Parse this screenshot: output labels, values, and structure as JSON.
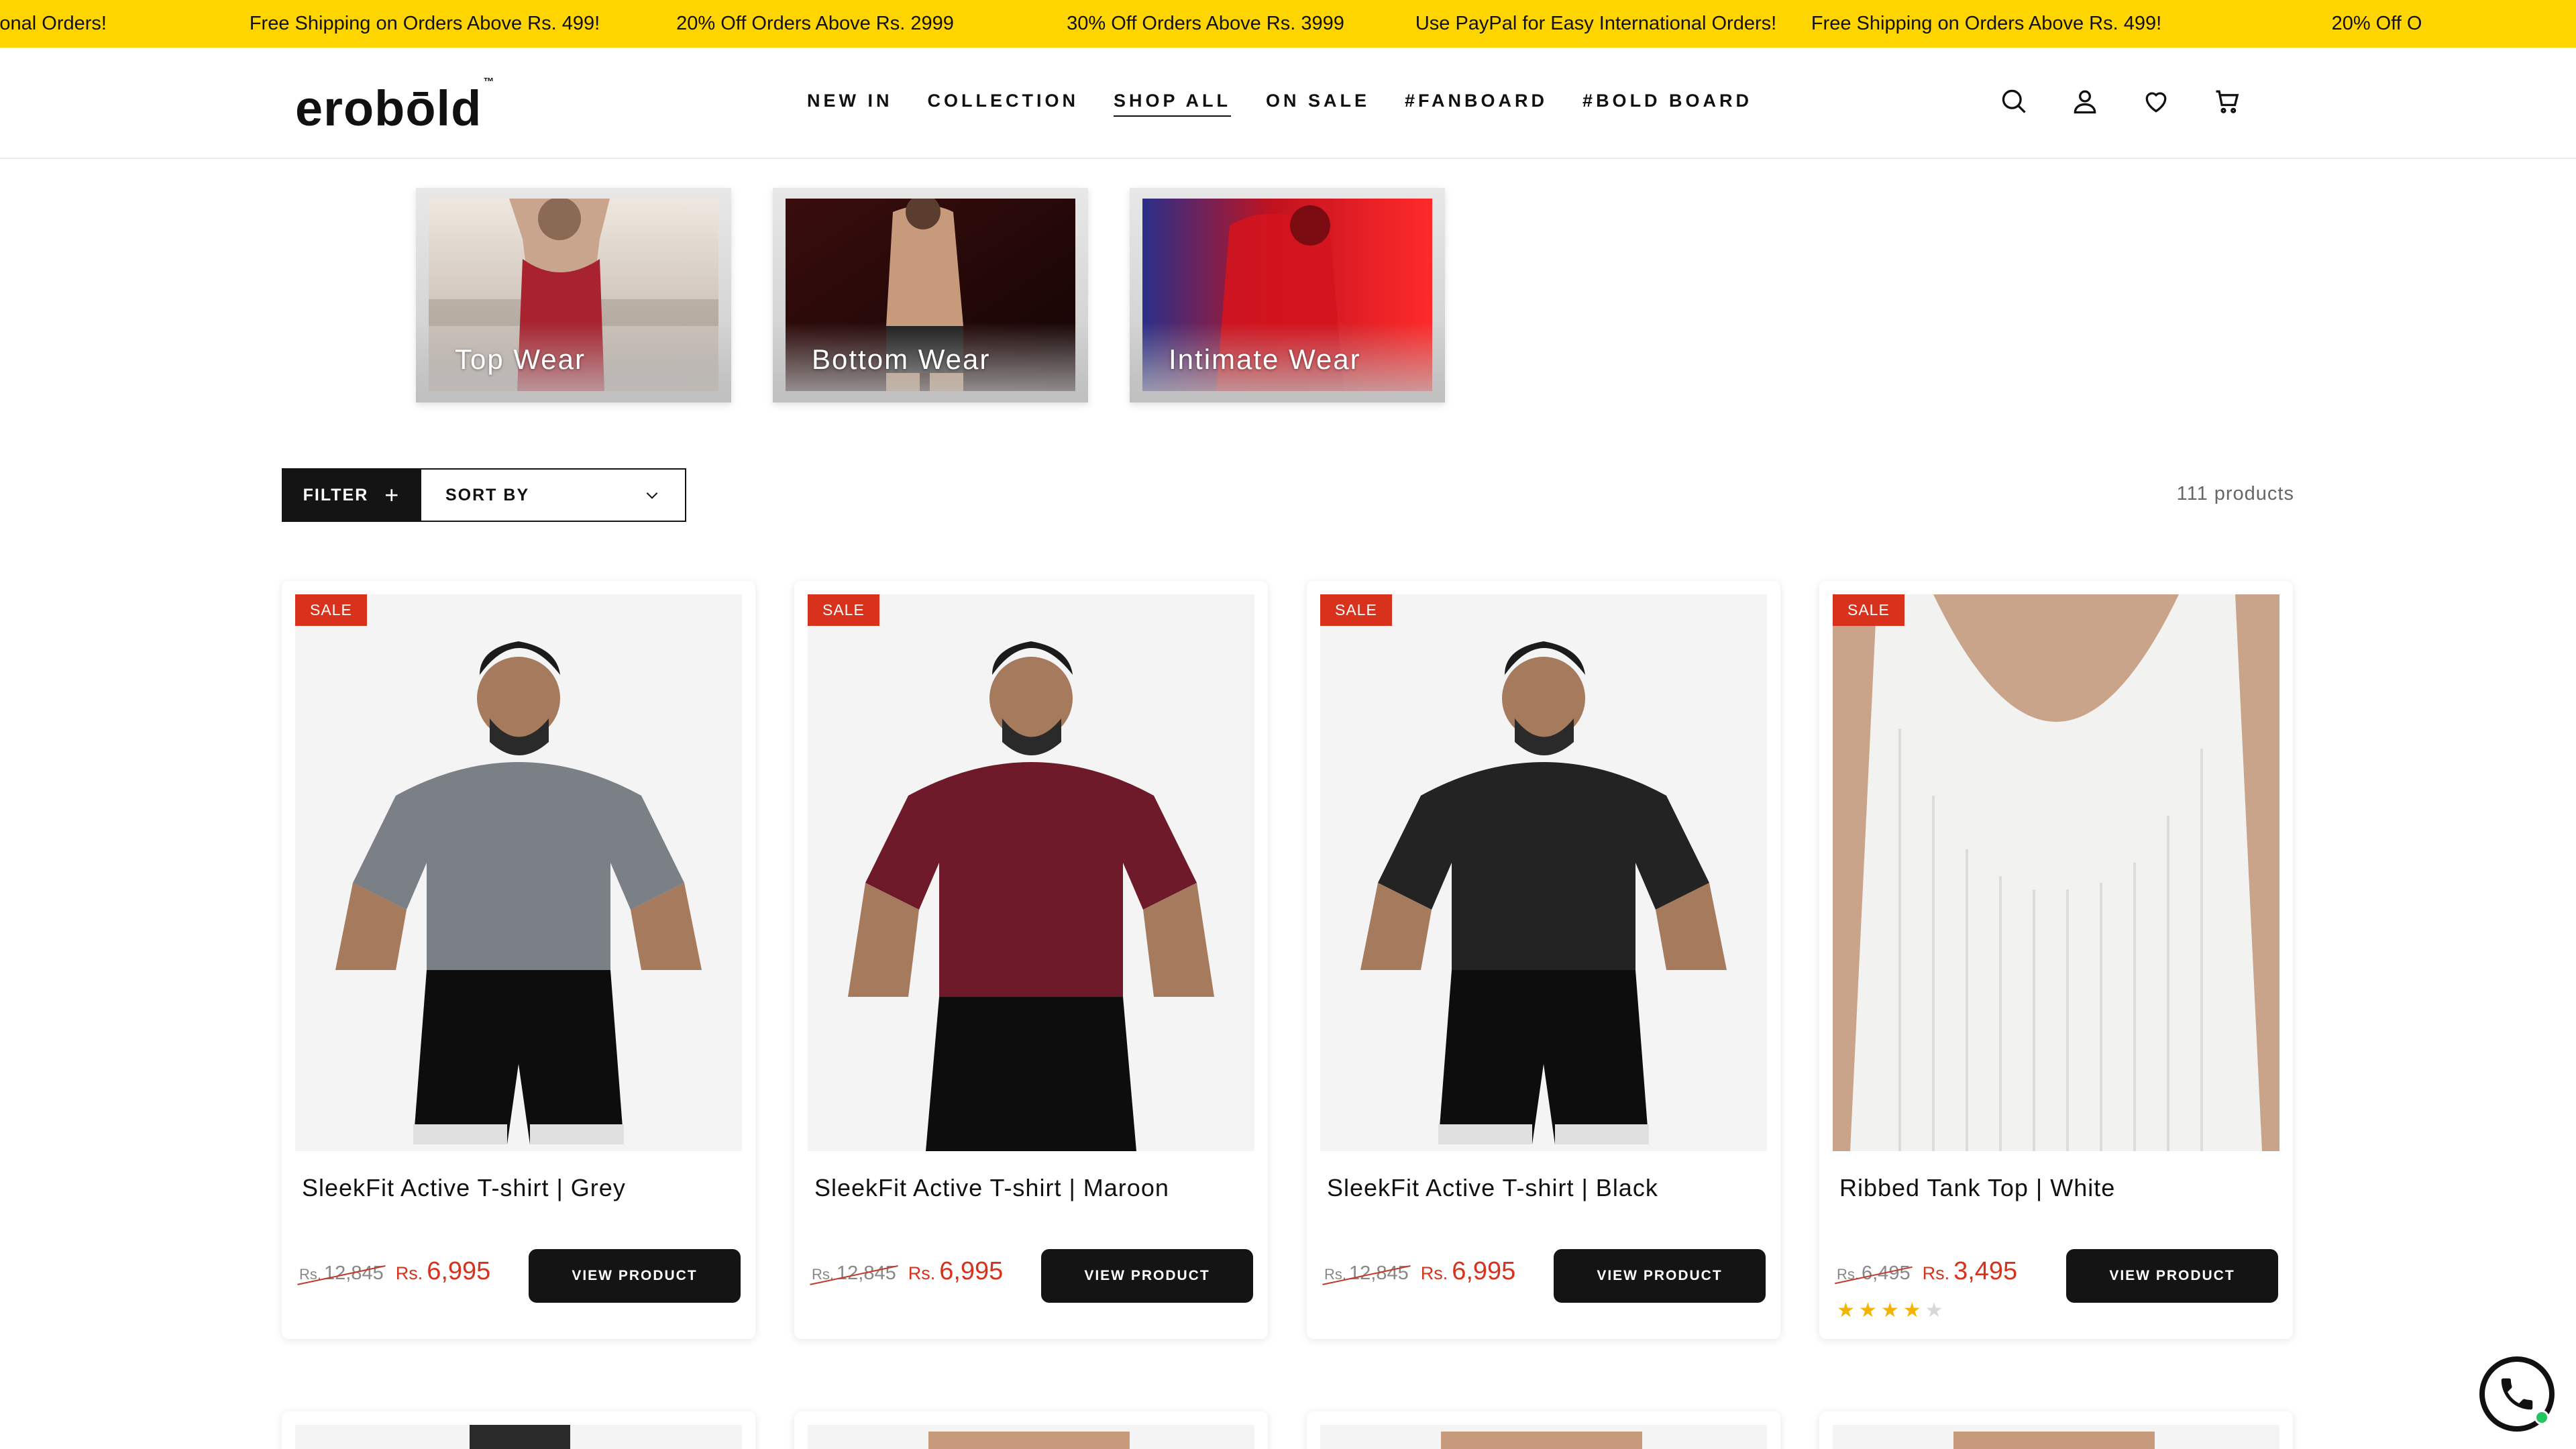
{
  "announcements": [
    "rnational Orders!",
    "Free Shipping on Orders Above Rs. 499!",
    "20% Off Orders Above Rs. 2999",
    "30% Off Orders Above Rs. 3999",
    "Use PayPal for Easy International Orders!",
    "Free Shipping on Orders Above Rs. 499!",
    "20% Off O"
  ],
  "header": {
    "logo": "erobōld",
    "logo_tm": "™",
    "nav": [
      "NEW IN",
      "COLLECTION",
      "SHOP ALL",
      "ON SALE",
      "#FANBOARD",
      "#BOLD BOARD"
    ],
    "active_nav": "SHOP ALL",
    "icons": [
      "search-icon",
      "account-icon",
      "wishlist-icon",
      "cart-icon"
    ]
  },
  "categories": [
    {
      "label": "Top Wear"
    },
    {
      "label": "Bottom Wear"
    },
    {
      "label": "Intimate Wear"
    }
  ],
  "toolbar": {
    "filter_label": "FILTER",
    "filter_icon": "+",
    "sort_label": "SORT BY",
    "product_count": "111 products"
  },
  "products": [
    {
      "badge": "SALE",
      "title": "SleekFit Active T-shirt | Grey",
      "currency": "Rs.",
      "old_price": "12,845",
      "new_price": "6,995",
      "button": "VIEW PRODUCT",
      "shirt_color": "#7b7f86"
    },
    {
      "badge": "SALE",
      "title": "SleekFit Active T-shirt | Maroon",
      "currency": "Rs.",
      "old_price": "12,845",
      "new_price": "6,995",
      "button": "VIEW PRODUCT",
      "shirt_color": "#6e1a2a"
    },
    {
      "badge": "SALE",
      "title": "SleekFit Active T-shirt | Black",
      "currency": "Rs.",
      "old_price": "12,845",
      "new_price": "6,995",
      "button": "VIEW PRODUCT",
      "shirt_color": "#232323"
    },
    {
      "badge": "SALE",
      "title": "Ribbed Tank Top | White",
      "currency": "Rs.",
      "old_price": "6,495",
      "new_price": "3,495",
      "button": "VIEW PRODUCT",
      "shirt_color": "#f2f2f0",
      "rating": 4,
      "rating_max": 5
    }
  ],
  "colors": {
    "announcement_bg": "#ffd500",
    "sale_red": "#d9321c",
    "button_dark": "#141414"
  }
}
